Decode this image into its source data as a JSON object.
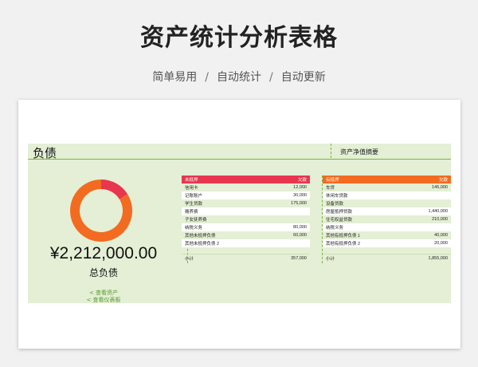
{
  "page": {
    "title": "资产统计分析表格",
    "subtitle": [
      "简单易用",
      "自动统计",
      "自动更新"
    ],
    "separator": "/"
  },
  "sheet": {
    "section_title": "负债",
    "summary_label": "资产净值摘要",
    "total_amount": "¥2,212,000.00",
    "total_label": "总负债",
    "link_assets": "< 查看资产",
    "link_dashboard": "< 查看仪表板"
  },
  "colors": {
    "red_header": "#e8364e",
    "orange_header": "#f26b21",
    "band": "#e4efd5",
    "green_line": "#7cb342"
  },
  "chart_data": {
    "type": "pie",
    "style": "donut",
    "categories": [
      "未抵押",
      "有抵押"
    ],
    "values": [
      357000,
      1855000
    ],
    "colors": [
      "#e8364e",
      "#f26b21"
    ]
  },
  "unsecured": {
    "header": {
      "name": "未抵押",
      "amount": "欠款"
    },
    "rows": [
      {
        "name": "信用卡",
        "amount": "12,000"
      },
      {
        "name": "记账账户",
        "amount": "30,000"
      },
      {
        "name": "学生贷款",
        "amount": "175,000"
      },
      {
        "name": "赡养费",
        "amount": ""
      },
      {
        "name": "子女抚养费",
        "amount": ""
      },
      {
        "name": "纳税义务",
        "amount": "80,000"
      },
      {
        "name": "其他未抵押负债",
        "amount": "60,000"
      },
      {
        "name": "其他未抵押负债 2",
        "amount": ""
      }
    ],
    "total": {
      "name": "小计",
      "amount": "357,000"
    }
  },
  "secured": {
    "header": {
      "name": "有抵押",
      "amount": "欠款"
    },
    "rows": [
      {
        "name": "车贷",
        "amount": "145,000"
      },
      {
        "name": "休闲车贷款",
        "amount": ""
      },
      {
        "name": "设备贷款",
        "amount": ""
      },
      {
        "name": "房屋抵押贷款",
        "amount": "1,440,000"
      },
      {
        "name": "住宅权益贷款",
        "amount": "210,000"
      },
      {
        "name": "纳税义务",
        "amount": ""
      },
      {
        "name": "其他有抵押负债 1",
        "amount": "40,000"
      },
      {
        "name": "其他有抵押负债 2",
        "amount": "20,000"
      }
    ],
    "total": {
      "name": "小计",
      "amount": "1,855,000"
    }
  }
}
